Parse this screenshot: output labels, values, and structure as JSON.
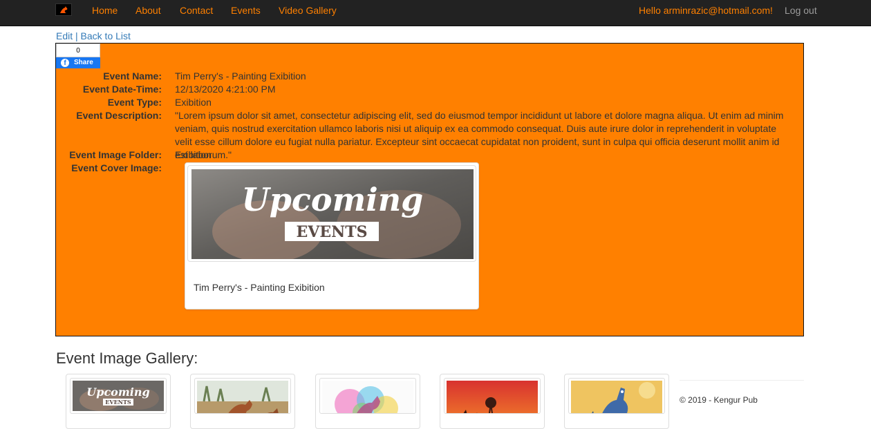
{
  "nav": {
    "logo_icon": "kangaroo-logo-icon",
    "links": [
      "Home",
      "About",
      "Contact",
      "Events",
      "Video Gallery"
    ],
    "greeting": "Hello arminrazic@hotmail.com!",
    "logout": "Log out"
  },
  "actions": {
    "edit": "Edit",
    "separator": "|",
    "back": "Back to List"
  },
  "share": {
    "count": "0",
    "label": "Share",
    "icon": "facebook-icon"
  },
  "details": {
    "event_name_label": "Event Name:",
    "event_name": "Tim Perry's - Painting Exibition",
    "event_datetime_label": "Event Date-Time:",
    "event_datetime": "12/13/2020 4:21:00 PM",
    "event_type_label": "Event Type:",
    "event_type": "Exibition",
    "event_description_label": "Event Description:",
    "event_description": "\"Lorem ipsum dolor sit amet, consectetur adipiscing elit, sed do eiusmod tempor incididunt ut labore et dolore magna aliqua. Ut enim ad minim veniam, quis nostrud exercitation ullamco laboris nisi ut aliquip ex ea commodo consequat. Duis aute irure dolor in reprehenderit in voluptate velit esse cillum dolore eu fugiat nulla pariatur. Excepteur sint occaecat cupidatat non proident, sunt in culpa qui officia deserunt mollit anim id est laborum.\"",
    "event_image_folder_label": "Event Image Folder:",
    "event_image_folder": "Exibition",
    "event_cover_image_label": "Event Cover Image:"
  },
  "cover_card": {
    "image_title": "Upcoming",
    "image_subtitle": "EVENTS",
    "caption": "Tim Perry's - Painting Exibition"
  },
  "gallery": {
    "title": "Event Image Gallery:",
    "items": [
      {
        "name": "upcoming-events-image",
        "title": "Upcoming",
        "subtitle": "EVENTS"
      },
      {
        "name": "kangaroo-painting-bush"
      },
      {
        "name": "kangaroo-painting-watercolor"
      },
      {
        "name": "kangaroo-painting-sunset"
      },
      {
        "name": "kangaroo-painting-colorful"
      }
    ]
  },
  "footer": {
    "text": "© 2019 - Kengur Pub"
  },
  "colors": {
    "accent": "#ff8000",
    "navbar": "#222222",
    "link": "#337ab7"
  }
}
